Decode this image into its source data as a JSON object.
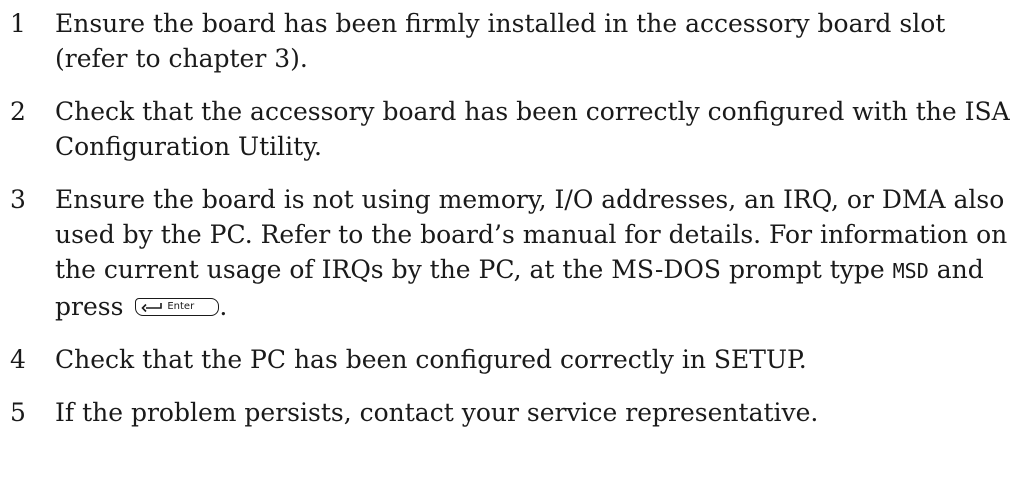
{
  "steps": [
    {
      "number": "1",
      "text": "Ensure the board has been firmly installed in the accessory board slot (refer to chapter 3)."
    },
    {
      "number": "2",
      "text": "Check that the accessory board has been correctly configured with the ISA Configuration Utility."
    },
    {
      "number": "3",
      "text_before_code": "Ensure the board is not using memory, I/O addresses, an IRQ, or DMA also used by the PC. Refer to the board’s manual for details. For information on the current usage of IRQs by the PC, at the MS-DOS prompt type ",
      "code": "MSD",
      "text_after_code": " and press ",
      "key_label": "Enter",
      "key_icon": "enter-arrow-icon",
      "text_end": "."
    },
    {
      "number": "4",
      "text": "Check that the PC has been configured correctly in SETUP."
    },
    {
      "number": "5",
      "text": "If the problem persists, contact your service representative."
    }
  ]
}
